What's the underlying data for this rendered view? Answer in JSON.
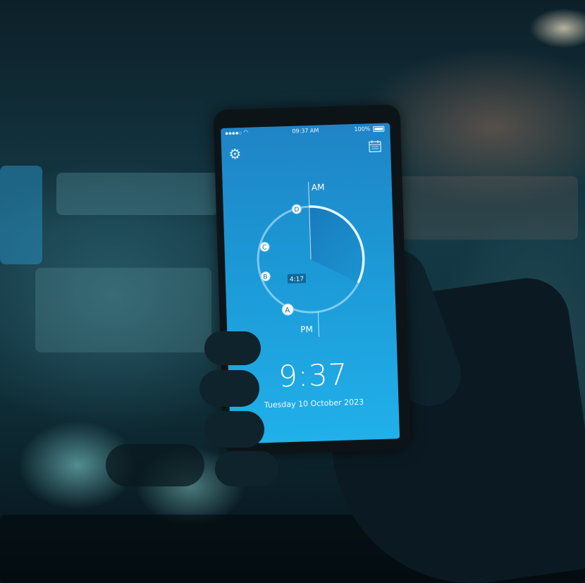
{
  "status_bar": {
    "signal": "●●●●○",
    "time": "09:37 AM",
    "battery": "100%"
  },
  "clock": {
    "am_label": "AM",
    "pm_label": "PM",
    "markers": [
      "A",
      "B",
      "C",
      "D"
    ],
    "duration_label": "4:17",
    "time": "9:37",
    "date": "Tuesday 10 October 2023"
  },
  "icons": {
    "settings": "gear-icon",
    "calendar": "calendar-icon",
    "wifi": "wifi-icon",
    "battery": "battery-icon"
  },
  "colors": {
    "screen_top": "#1f84c6",
    "screen_bottom": "#21b0ea",
    "ring": "#cfeeff"
  }
}
